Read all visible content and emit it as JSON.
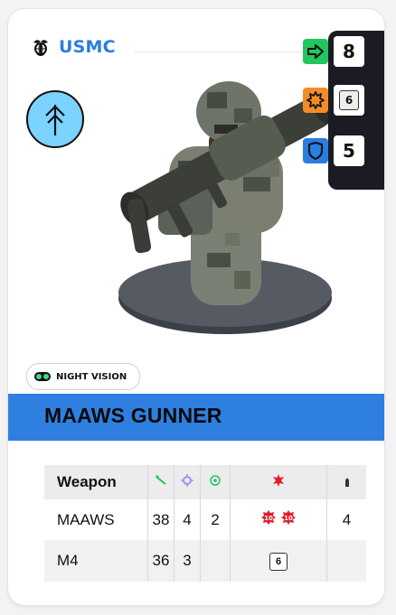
{
  "faction": {
    "name": "USMC",
    "color": "#2a7de1"
  },
  "unit_symbol": {
    "icon": "arrow-up-trident-icon",
    "color": "#7dd3ff"
  },
  "stats": {
    "movement": {
      "icon": "arrow-right-icon",
      "value": "8",
      "color": "#22c55e"
    },
    "quality": {
      "icon": "burst-icon",
      "value": "6",
      "color": "#f28c28"
    },
    "defense": {
      "icon": "shield-icon",
      "value": "5",
      "color": "#2a7de1"
    }
  },
  "ability": {
    "icon": "night-vision-goggles-icon",
    "label": "NIGHT VISION"
  },
  "unit_name": "MAAWS GUNNER",
  "weapons": {
    "headers": {
      "weapon": "Weapon",
      "range_icon": "range-line-icon",
      "attacks_icon": "crosshair-icon",
      "ap_icon": "target-icon",
      "damage_icon": "explosion-icon",
      "ammo_icon": "bullet-icon"
    },
    "rows": [
      {
        "name": "MAAWS",
        "range": "38",
        "attacks": "4",
        "ap": "2",
        "damage_dice": [
          "10",
          "10"
        ],
        "ammo": "4"
      },
      {
        "name": "M4",
        "range": "36",
        "attacks": "3",
        "ap": "",
        "damage_dice": [
          "6"
        ],
        "ammo": ""
      }
    ]
  }
}
